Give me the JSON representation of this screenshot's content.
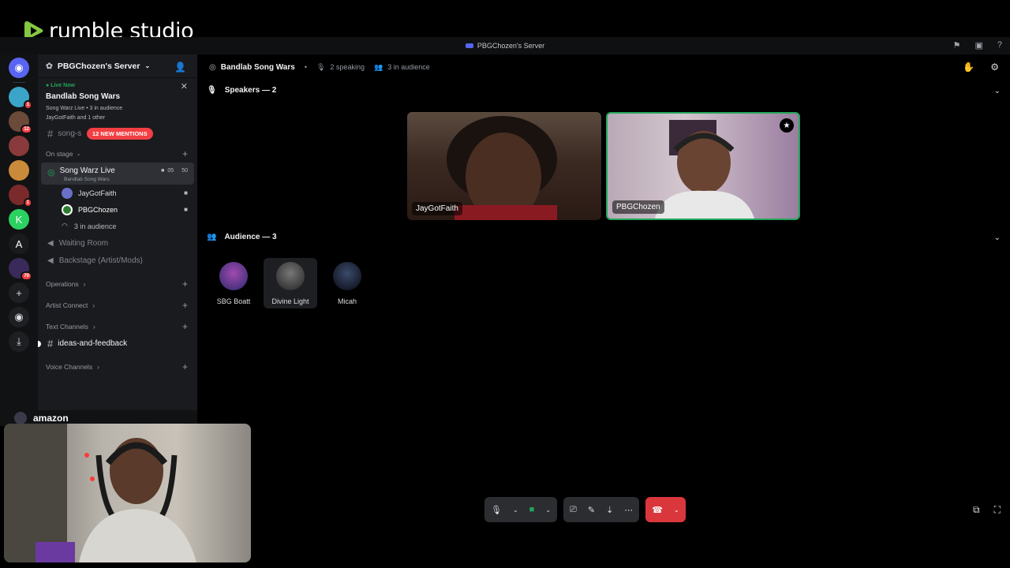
{
  "brand": {
    "name": "rumble studio"
  },
  "window": {
    "title": "PBGChozen's Server"
  },
  "guilds": [
    {
      "name": "direct-messages",
      "color": "#5865f2",
      "glyph": "◉",
      "badge": ""
    },
    {
      "name": "server-1",
      "color": "#3ba5c9",
      "glyph": "",
      "badge": "1"
    },
    {
      "name": "server-2",
      "color": "#6b4a3a",
      "glyph": "",
      "badge": "12"
    },
    {
      "name": "server-3",
      "color": "#8a3a3a",
      "glyph": "",
      "badge": ""
    },
    {
      "name": "server-4",
      "color": "#c98a3a",
      "glyph": "",
      "badge": ""
    },
    {
      "name": "server-5",
      "color": "#7a2a2a",
      "glyph": "",
      "badge": "1"
    },
    {
      "name": "server-kick",
      "color": "#2bd161",
      "glyph": "K",
      "badge": ""
    },
    {
      "name": "server-a",
      "color": "#1a1b1e",
      "glyph": "A",
      "badge": ""
    },
    {
      "name": "server-6",
      "color": "#3a2a5a",
      "glyph": "",
      "badge": "70"
    }
  ],
  "sidebar": {
    "server_name": "PBGChozen's Server",
    "live": {
      "status": "Live Now",
      "title": "Bandlab Song Wars",
      "subtitle": "Song Warz Live • 3 in audience",
      "users": "JayGotFaith and 1 other"
    },
    "song_channel": "song-s",
    "mentions": "12 NEW MENTIONS",
    "cat_on_stage": "On stage",
    "stage_channel": {
      "name": "Song Warz Live",
      "topic": "Bandlab Song Wars",
      "video_count": "05",
      "user_count": "50"
    },
    "members": [
      {
        "name": "JayGotFaith",
        "color": "#7b7fd6"
      },
      {
        "name": "PBGChozen",
        "color": "#ffffff"
      }
    ],
    "audience_line": "3 in audience",
    "voice_channels": [
      "Waiting Room",
      "Backstage (Artist/Mods)"
    ],
    "cat_operations": "Operations",
    "cat_artist_connect": "Artist Connect",
    "cat_text_channels": "Text Channels",
    "text_channel": "ideas-and-feedback",
    "cat_voice_channels": "Voice Channels"
  },
  "topbar": {
    "title": "Bandlab Song Wars",
    "speaking": "2 speaking",
    "audience": "3 in audience"
  },
  "speakers": {
    "heading": "Speakers — 2",
    "tiles": [
      {
        "name": "JayGotFaith"
      },
      {
        "name": "PBGChozen"
      }
    ]
  },
  "audience": {
    "heading": "Audience — 3",
    "members": [
      {
        "name": "SBG Boatt"
      },
      {
        "name": "Divine Light"
      },
      {
        "name": "Micah"
      }
    ]
  },
  "overlay": {
    "sponsor": "amazon"
  }
}
